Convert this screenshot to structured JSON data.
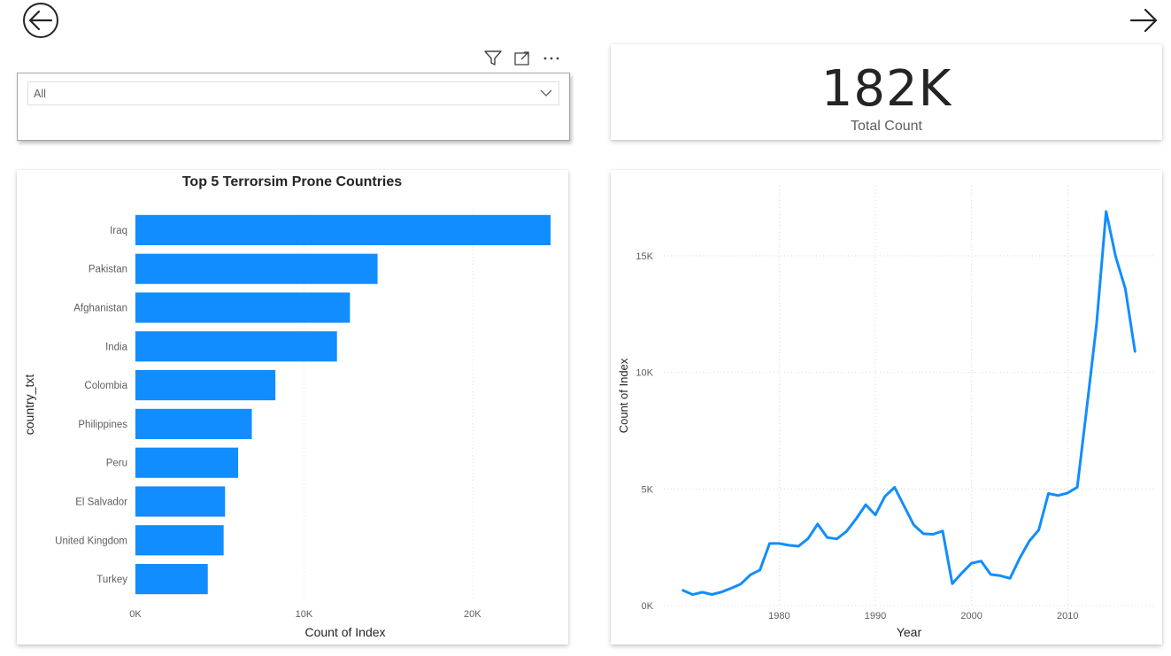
{
  "slicer": {
    "selected": "All"
  },
  "kpi": {
    "value": "182K",
    "label": "Total Count"
  },
  "icons": [
    "back-arrow-icon",
    "forward-arrow-icon",
    "filter-icon",
    "focus-mode-icon",
    "more-options-icon",
    "chevron-down-icon"
  ],
  "colors": {
    "bar": "#118dff",
    "line": "#118dff",
    "grid": "#e6e6e6"
  },
  "chart_data": [
    {
      "type": "bar",
      "orientation": "horizontal",
      "title": "Top 5 Terrorsim Prone Countries",
      "xlabel": "Count of Index",
      "ylabel": "country_txt",
      "categories": [
        "Iraq",
        "Pakistan",
        "Afghanistan",
        "India",
        "Colombia",
        "Philippines",
        "Peru",
        "El Salvador",
        "United Kingdom",
        "Turkey"
      ],
      "values": [
        24636,
        14368,
        12731,
        11960,
        8306,
        6908,
        6096,
        5320,
        5235,
        4292
      ],
      "xlim": [
        0,
        25000
      ],
      "xticks": [
        "0K",
        "10K",
        "20K"
      ],
      "xtick_values": [
        0,
        10000,
        20000
      ],
      "grid": true
    },
    {
      "type": "line",
      "title": "",
      "xlabel": "Year",
      "ylabel": "Count of Index",
      "x": [
        1970,
        1971,
        1972,
        1973,
        1974,
        1975,
        1976,
        1977,
        1978,
        1979,
        1980,
        1981,
        1982,
        1983,
        1984,
        1985,
        1986,
        1987,
        1988,
        1989,
        1990,
        1991,
        1992,
        1994,
        1995,
        1996,
        1997,
        1998,
        1999,
        2000,
        2001,
        2002,
        2003,
        2004,
        2005,
        2006,
        2007,
        2008,
        2009,
        2010,
        2011,
        2012,
        2013,
        2014,
        2015,
        2016,
        2017
      ],
      "y": [
        651,
        471,
        568,
        473,
        581,
        740,
        923,
        1319,
        1526,
        2662,
        2662,
        2586,
        2544,
        2870,
        3495,
        2915,
        2860,
        3183,
        3721,
        4324,
        3887,
        4683,
        5071,
        3456,
        3081,
        3058,
        3197,
        934,
        1395,
        1814,
        1906,
        1333,
        1278,
        1166,
        2017,
        2758,
        3242,
        4805,
        4721,
        4826,
        5076,
        8522,
        12036,
        16903,
        14965,
        13587,
        10900
      ],
      "xlim": [
        1968,
        2019
      ],
      "ylim": [
        0,
        18000
      ],
      "xticks": [
        "1980",
        "1990",
        "2000",
        "2010"
      ],
      "xtick_values": [
        1980,
        1990,
        2000,
        2010
      ],
      "yticks": [
        "0K",
        "5K",
        "10K",
        "15K"
      ],
      "ytick_values": [
        0,
        5000,
        10000,
        15000
      ],
      "grid": true
    }
  ]
}
